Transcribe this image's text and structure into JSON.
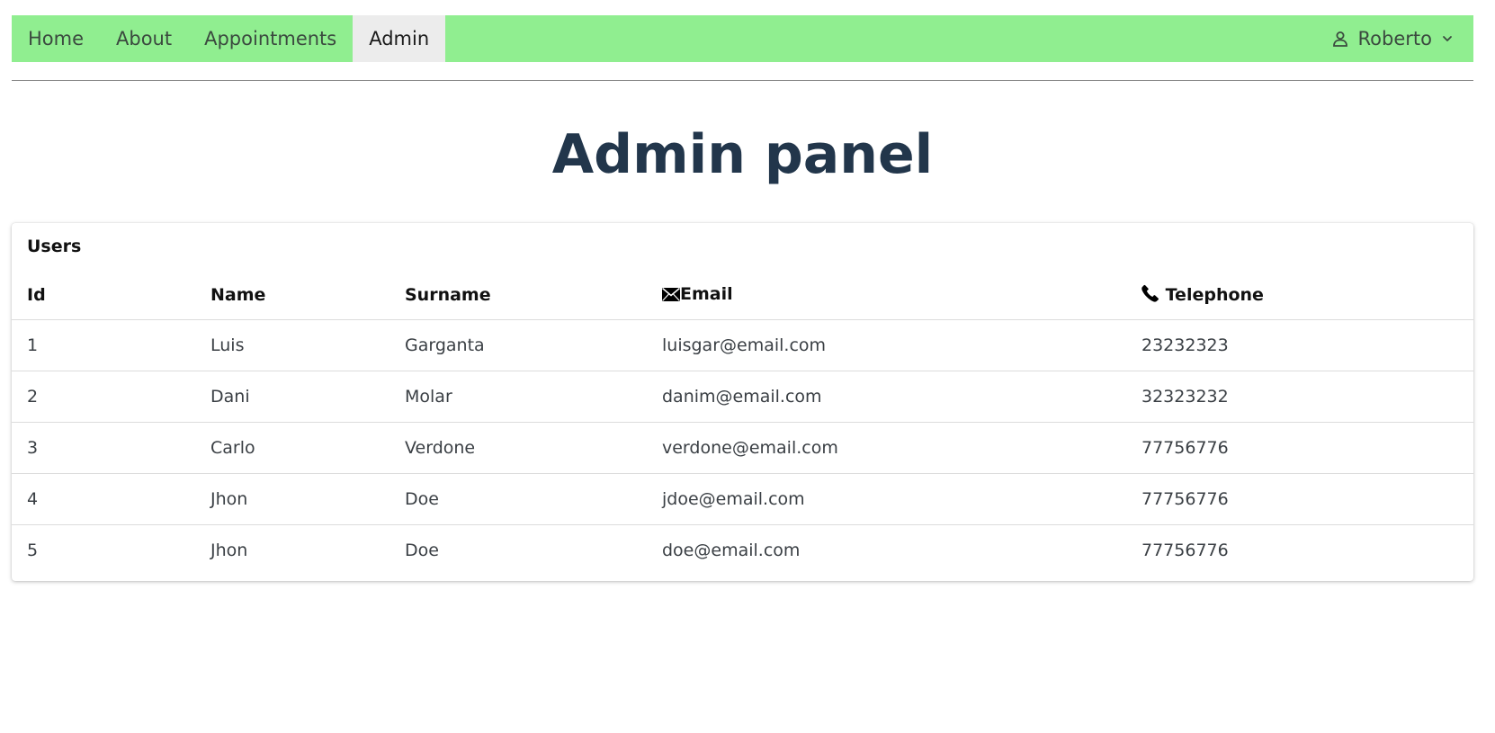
{
  "nav": {
    "items": [
      {
        "label": "Home"
      },
      {
        "label": "About"
      },
      {
        "label": "Appointments"
      },
      {
        "label": "Admin"
      }
    ],
    "active": "Admin",
    "user": {
      "name": "Roberto",
      "icon": "person-icon",
      "caret_icon": "chevron-down-icon"
    },
    "background_color": "#90ee90",
    "active_background_color": "#ececec"
  },
  "page": {
    "title": "Admin panel",
    "title_color": "#22364b"
  },
  "users_card": {
    "title": "Users",
    "columns": [
      {
        "label": "Id"
      },
      {
        "label": "Name"
      },
      {
        "label": "Surname"
      },
      {
        "label": "Email",
        "icon": "envelope-icon"
      },
      {
        "label": "Telephone",
        "icon": "phone-icon"
      }
    ],
    "rows": [
      {
        "id": "1",
        "name": "Luis",
        "surname": "Garganta",
        "email": "luisgar@email.com",
        "telephone": "23232323"
      },
      {
        "id": "2",
        "name": "Dani",
        "surname": "Molar",
        "email": "danim@email.com",
        "telephone": "32323232"
      },
      {
        "id": "3",
        "name": "Carlo",
        "surname": "Verdone",
        "email": "verdone@email.com",
        "telephone": "77756776"
      },
      {
        "id": "4",
        "name": "Jhon",
        "surname": "Doe",
        "email": "jdoe@email.com",
        "telephone": "77756776"
      },
      {
        "id": "5",
        "name": "Jhon",
        "surname": "Doe",
        "email": "doe@email.com",
        "telephone": "77756776"
      }
    ]
  }
}
